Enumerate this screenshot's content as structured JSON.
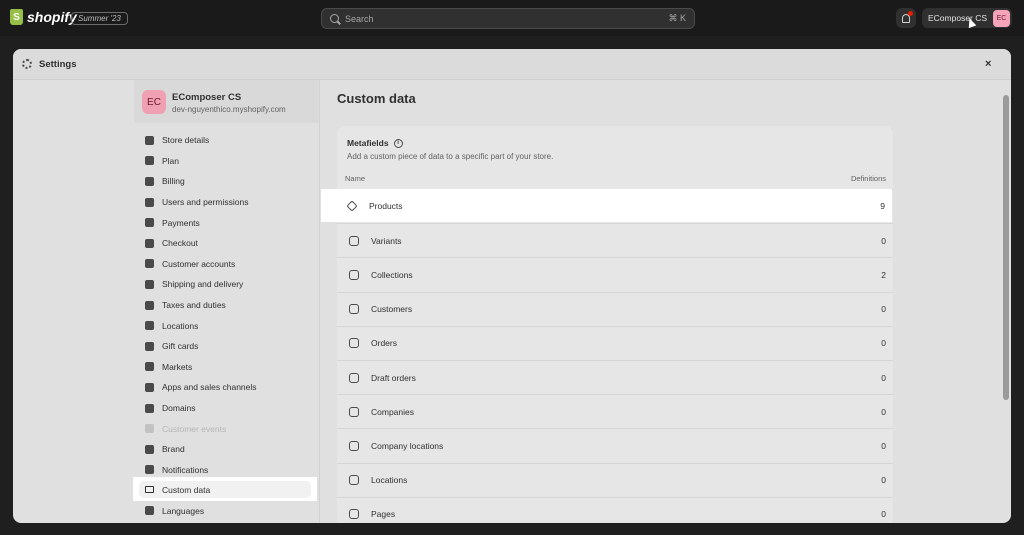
{
  "topbar": {
    "brand": "shopify",
    "brand_logo_letter": "S",
    "edition_badge": "Summer '23",
    "search_placeholder": "Search",
    "search_shortcut": "⌘ K",
    "store_switcher_label": "EComposer CS",
    "store_avatar_initials": "EC"
  },
  "modal": {
    "title": "Settings",
    "close": "×"
  },
  "sidebar": {
    "store_initials": "EC",
    "store_name": "EComposer CS",
    "store_domain": "dev-nguyenthico.myshopify.com",
    "items": [
      {
        "label": "Store details",
        "icon": "store-icon"
      },
      {
        "label": "Plan",
        "icon": "plan-icon"
      },
      {
        "label": "Billing",
        "icon": "billing-icon"
      },
      {
        "label": "Users and permissions",
        "icon": "users-icon"
      },
      {
        "label": "Payments",
        "icon": "payments-icon"
      },
      {
        "label": "Checkout",
        "icon": "cart-icon"
      },
      {
        "label": "Customer accounts",
        "icon": "customer-icon"
      },
      {
        "label": "Shipping and delivery",
        "icon": "truck-icon"
      },
      {
        "label": "Taxes and duties",
        "icon": "tax-icon"
      },
      {
        "label": "Locations",
        "icon": "location-icon"
      },
      {
        "label": "Gift cards",
        "icon": "gift-card-icon"
      },
      {
        "label": "Markets",
        "icon": "globe-icon"
      },
      {
        "label": "Apps and sales channels",
        "icon": "apps-icon"
      },
      {
        "label": "Domains",
        "icon": "globe-icon"
      },
      {
        "label": "Customer events",
        "icon": "events-icon"
      },
      {
        "label": "Brand",
        "icon": "brand-icon"
      },
      {
        "label": "Notifications",
        "icon": "bell-icon"
      },
      {
        "label": "Custom data",
        "icon": "custom-data-icon"
      },
      {
        "label": "Languages",
        "icon": "language-icon"
      }
    ]
  },
  "content": {
    "title": "Custom data",
    "metafields_title": "Metafields",
    "info_glyph": "i",
    "metafields_subtitle": "Add a custom piece of data to a specific part of your store.",
    "col_name": "Name",
    "col_definitions": "Definitions",
    "rows": [
      {
        "label": "Products",
        "count": "9",
        "icon": "tag-icon"
      },
      {
        "label": "Variants",
        "count": "0",
        "icon": "variants-icon"
      },
      {
        "label": "Collections",
        "count": "2",
        "icon": "collection-icon"
      },
      {
        "label": "Customers",
        "count": "0",
        "icon": "person-icon"
      },
      {
        "label": "Orders",
        "count": "0",
        "icon": "inbox-icon"
      },
      {
        "label": "Draft orders",
        "count": "0",
        "icon": "draft-icon"
      },
      {
        "label": "Companies",
        "count": "0",
        "icon": "company-icon"
      },
      {
        "label": "Company locations",
        "count": "0",
        "icon": "company-location-icon"
      },
      {
        "label": "Locations",
        "count": "0",
        "icon": "location-icon"
      },
      {
        "label": "Pages",
        "count": "0",
        "icon": "page-icon"
      }
    ]
  }
}
